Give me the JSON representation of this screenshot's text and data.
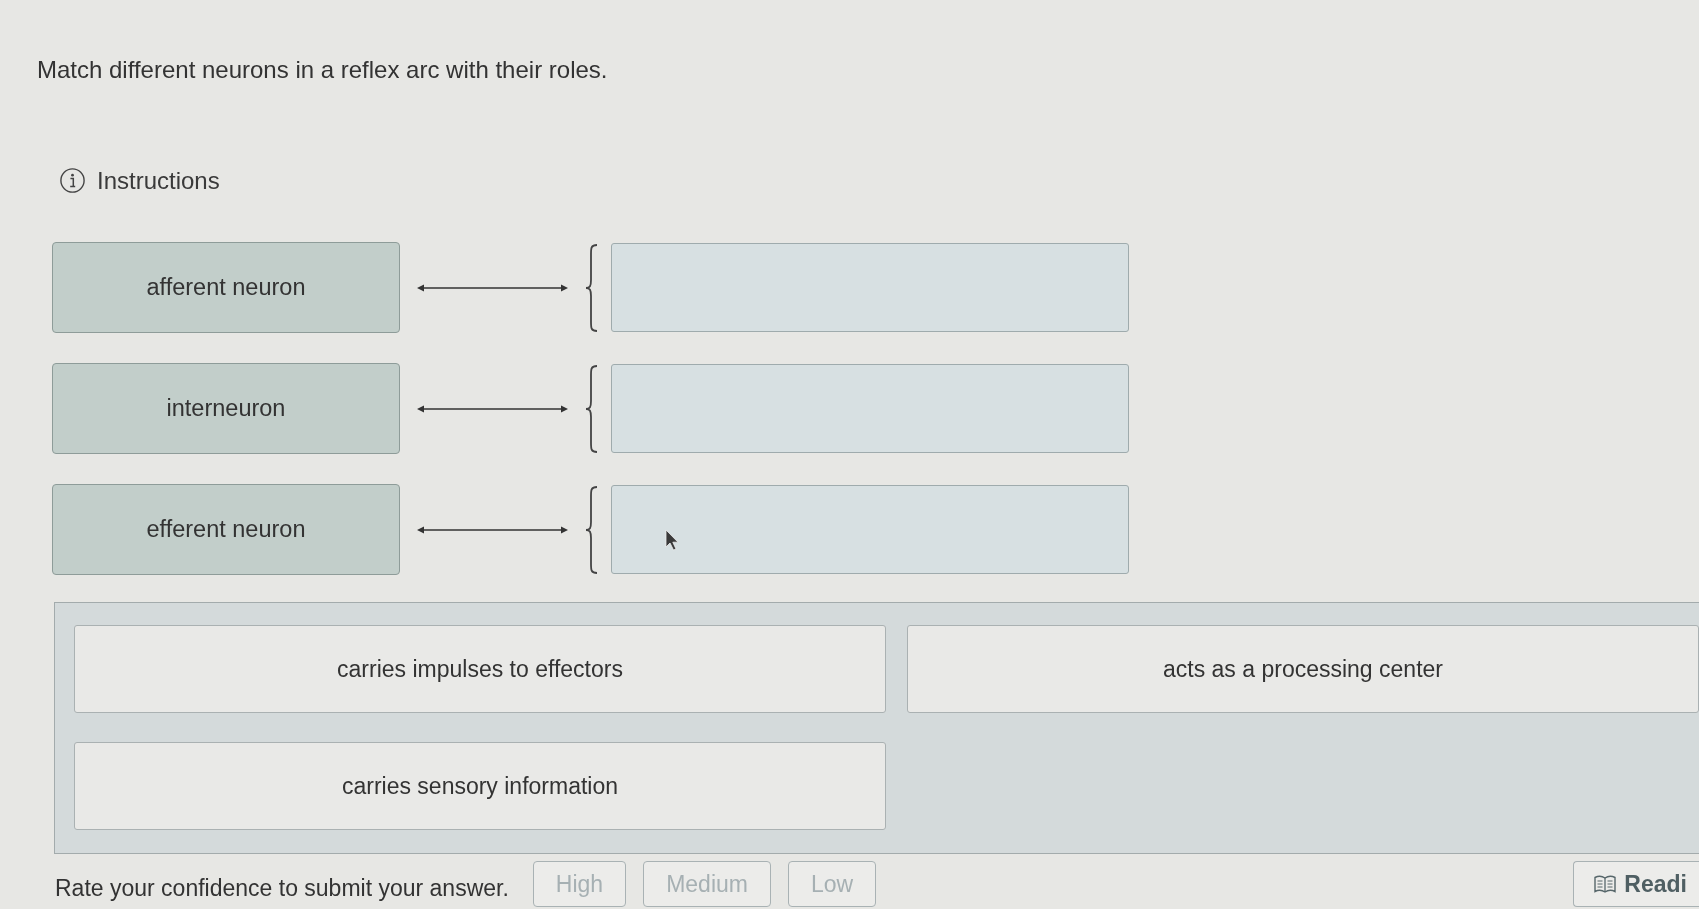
{
  "question": {
    "prompt": "Match different neurons in a reflex arc with their roles.",
    "instructions_link": "Instructions"
  },
  "match_rows": [
    {
      "term": "afferent neuron"
    },
    {
      "term": "interneuron"
    },
    {
      "term": "efferent neuron"
    }
  ],
  "answer_bank": [
    {
      "text": "carries impulses to effectors"
    },
    {
      "text": "acts as a processing center"
    },
    {
      "text": "carries sensory information"
    }
  ],
  "confidence": {
    "prompt": "Rate your confidence to submit your answer.",
    "options": [
      {
        "label": "High",
        "selected": false,
        "disabled": true
      },
      {
        "label": "Medium",
        "selected": false,
        "disabled": true
      },
      {
        "label": "Low",
        "selected": false,
        "disabled": true
      }
    ]
  },
  "reading_button": {
    "label": "Readi"
  }
}
